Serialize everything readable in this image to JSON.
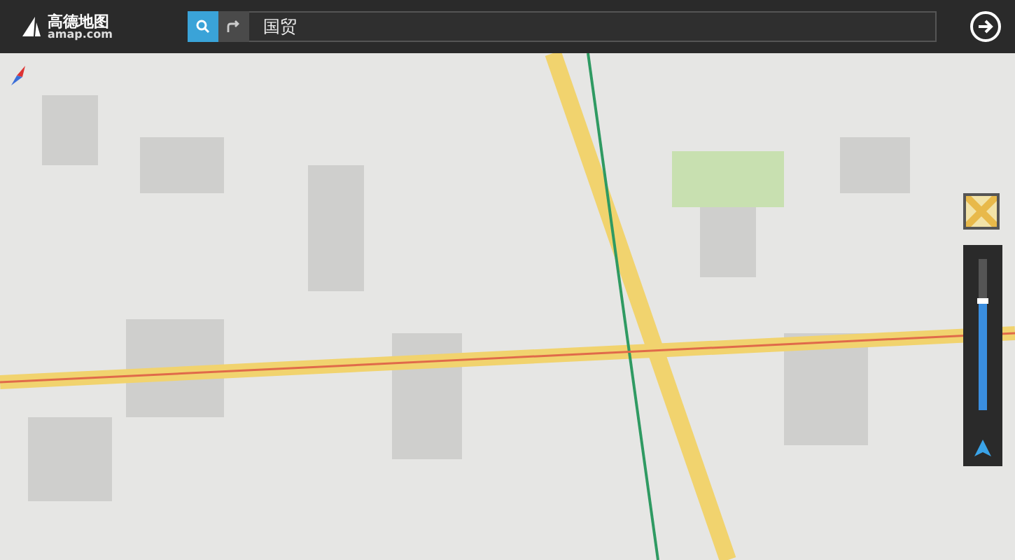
{
  "header": {
    "logo": {
      "name": "高德地图",
      "domain": "amap.com"
    },
    "search": {
      "value": "国贸"
    }
  },
  "zoom": {
    "level": 0.72
  }
}
